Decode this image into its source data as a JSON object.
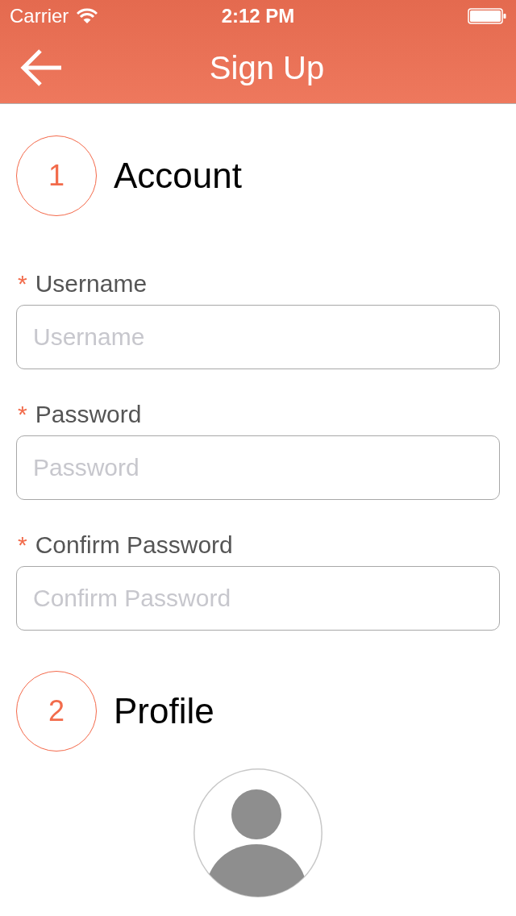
{
  "status_bar": {
    "carrier": "Carrier",
    "time": "2:12 PM"
  },
  "nav_bar": {
    "title": "Sign Up"
  },
  "sections": [
    {
      "kind": "form",
      "number": "1",
      "title": "Account",
      "fields": [
        {
          "label": "Username",
          "required_mark": "*",
          "placeholder": "Username"
        },
        {
          "label": "Password",
          "required_mark": "*",
          "placeholder": "Password"
        },
        {
          "label": "Confirm Password",
          "required_mark": "*",
          "placeholder": "Confirm Password"
        }
      ]
    },
    {
      "kind": "avatar",
      "number": "2",
      "title": "Profile"
    }
  ]
}
